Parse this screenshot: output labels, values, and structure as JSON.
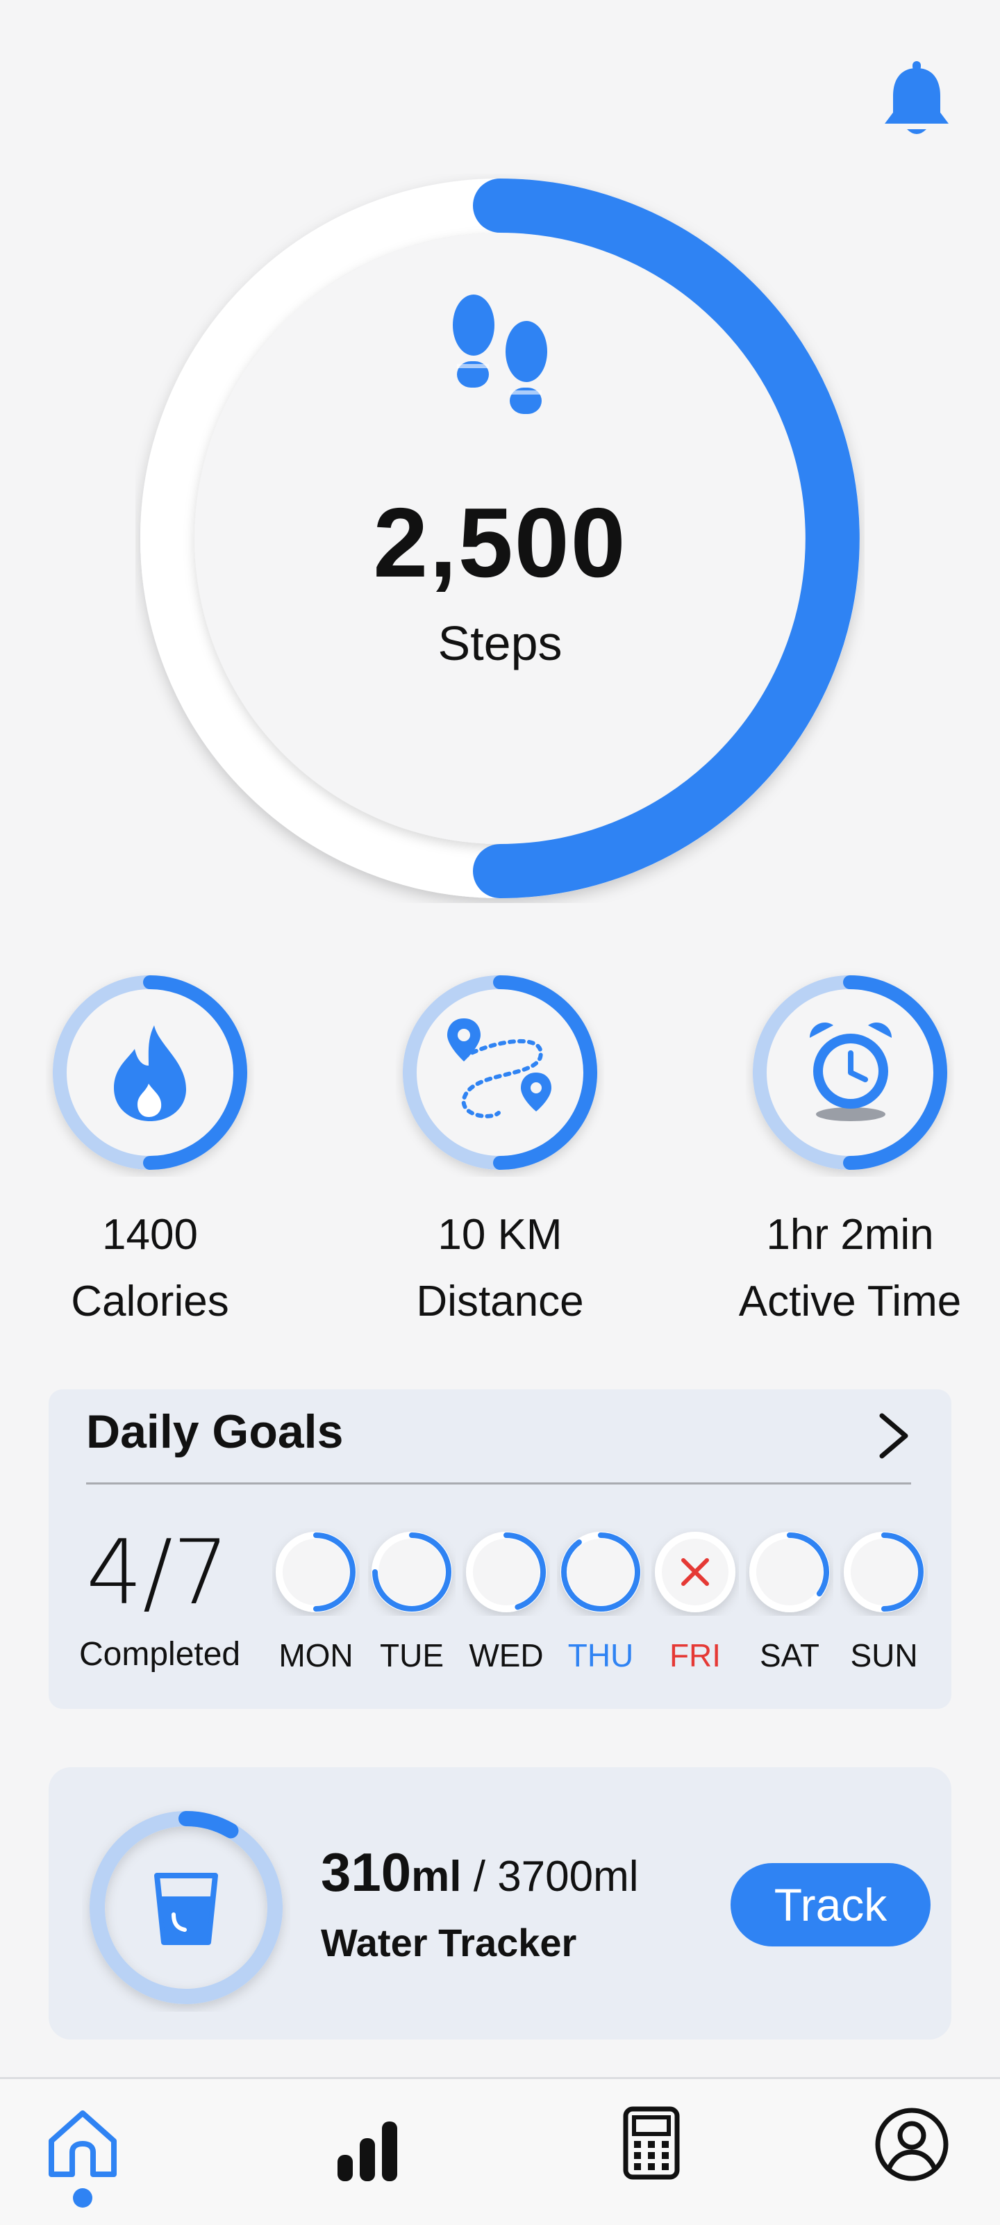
{
  "colors": {
    "accent": "#2f83f3",
    "accent_light": "#b9d2f5",
    "background": "#f5f5f6",
    "card": "#e9edf4",
    "missed": "#e53935"
  },
  "header": {
    "notification_icon": "bell-icon"
  },
  "steps": {
    "value": "2,500",
    "label": "Steps",
    "progress": 0.5,
    "icon": "footprints-icon"
  },
  "stats": [
    {
      "value": "1400",
      "label": "Calories",
      "icon": "flame-icon",
      "progress": 0.5
    },
    {
      "value": "10 KM",
      "label": "Distance",
      "icon": "route-map-icon",
      "progress": 0.5
    },
    {
      "value": "1hr 2min",
      "label": "Active Time",
      "icon": "alarm-clock-icon",
      "progress": 0.5
    }
  ],
  "daily_goals": {
    "title": "Daily Goals",
    "completed": "4/7",
    "completed_label": "Completed",
    "days": [
      {
        "label": "MON",
        "progress": 0.5,
        "state": "normal"
      },
      {
        "label": "TUE",
        "progress": 0.75,
        "state": "normal"
      },
      {
        "label": "WED",
        "progress": 0.45,
        "state": "normal"
      },
      {
        "label": "THU",
        "progress": 0.9,
        "state": "current"
      },
      {
        "label": "FRI",
        "progress": 0,
        "state": "missed"
      },
      {
        "label": "SAT",
        "progress": 0.35,
        "state": "normal"
      },
      {
        "label": "SUN",
        "progress": 0.5,
        "state": "normal"
      }
    ]
  },
  "water": {
    "amount": "310",
    "unit": "ml",
    "separator": " / ",
    "goal": "3700ml",
    "title": "Water Tracker",
    "button": "Track",
    "progress": 0.084,
    "icon": "water-glass-icon"
  },
  "nav": {
    "items": [
      {
        "name": "home",
        "icon": "home-icon",
        "active": true
      },
      {
        "name": "stats",
        "icon": "bar-chart-icon",
        "active": false
      },
      {
        "name": "calculator",
        "icon": "calculator-icon",
        "active": false
      },
      {
        "name": "profile",
        "icon": "profile-icon",
        "active": false
      }
    ]
  }
}
